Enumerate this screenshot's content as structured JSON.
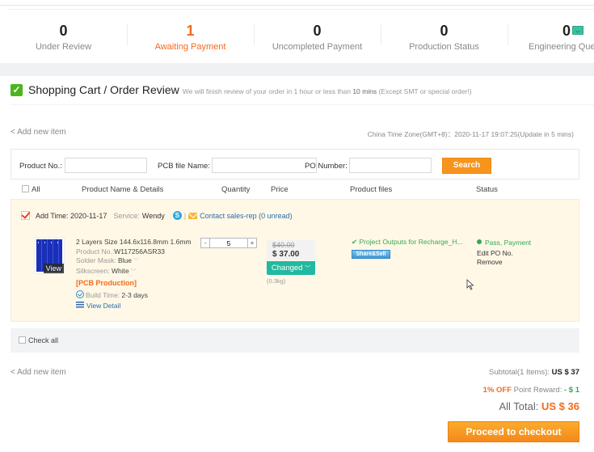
{
  "stats": [
    {
      "count": "0",
      "label": "Under Review",
      "active": false
    },
    {
      "count": "1",
      "label": "Awaiting Payment",
      "active": true
    },
    {
      "count": "0",
      "label": "Uncompleted Payment",
      "active": false
    },
    {
      "count": "0",
      "label": "Production Status",
      "active": false
    },
    {
      "count": "0",
      "label": "Engineering Questions",
      "active": false,
      "icon": "monitor-icon"
    }
  ],
  "header": {
    "title": "Shopping Cart / Order Review",
    "subtitle_pre": "We will finish review of your order in 1 hour or less than",
    "subtitle_bold": "10 mins",
    "subtitle_post": "(Except SMT or special order!)"
  },
  "add_new_item": "< Add new item",
  "timezone": "China Time Zone(GMT+8)：2020-11-17 19:07:25(Update in 5 mins)",
  "search": {
    "product_no_label": "Product No.:",
    "product_no_value": "",
    "pcb_file_label": "PCB file Name:",
    "pcb_file_value": "",
    "po_number_label": "PO Number:",
    "po_number_value": "",
    "button": "Search"
  },
  "columns": {
    "all": "All",
    "product": "Product Name & Details",
    "quantity": "Quantity",
    "price": "Price",
    "files": "Product files",
    "status": "Status"
  },
  "item": {
    "checked": true,
    "add_time": "Add Time: 2020-11-17",
    "service_label": "Service:",
    "service_name": "Wendy",
    "contact": "Contact sales-rep (0 unread)",
    "thumb_view": "View",
    "spec": "2 Layers Size 144.6x116.8mm 1.6mm",
    "product_no_label": "Product No.:",
    "product_no": "W117256ASR33",
    "solder_label": "Solder Mask:",
    "solder_value": "Blue",
    "silk_label": "Silkscreen:",
    "silk_value": "White",
    "category": "[PCB Production]",
    "build_label": "Build Time:",
    "build_value": "2-3 days",
    "view_detail": "View Detail",
    "qty_minus": "-",
    "qty_plus": "+",
    "quantity": "5",
    "old_price": "$40.00",
    "new_price": "$ 37.00",
    "changed": "Changed",
    "weight": "(0.3kg)",
    "file_name": "Project Outputs for Recharge_H...",
    "share_sell": "Share&Sell",
    "status": "Pass, Payment",
    "edit_po": "Edit PO No.",
    "remove": "Remove"
  },
  "check_all": "Check all",
  "totals": {
    "subtotal_label": "Subtotal(1 Items):",
    "subtotal_value": "US $ 37",
    "reward_off": "1% OFF",
    "reward_label": "Point Reward:",
    "reward_value": "- $ 1",
    "all_total_label": "All Total:",
    "all_total_value": "US $ 36",
    "checkout": "Proceed to checkout"
  },
  "colors": {
    "accent_orange": "#f26b1d",
    "button_orange": "#f7941d",
    "teal": "#21b9a0",
    "green": "#34a853",
    "link_blue": "#2b6cb0",
    "item_bg": "#fff8e6"
  }
}
